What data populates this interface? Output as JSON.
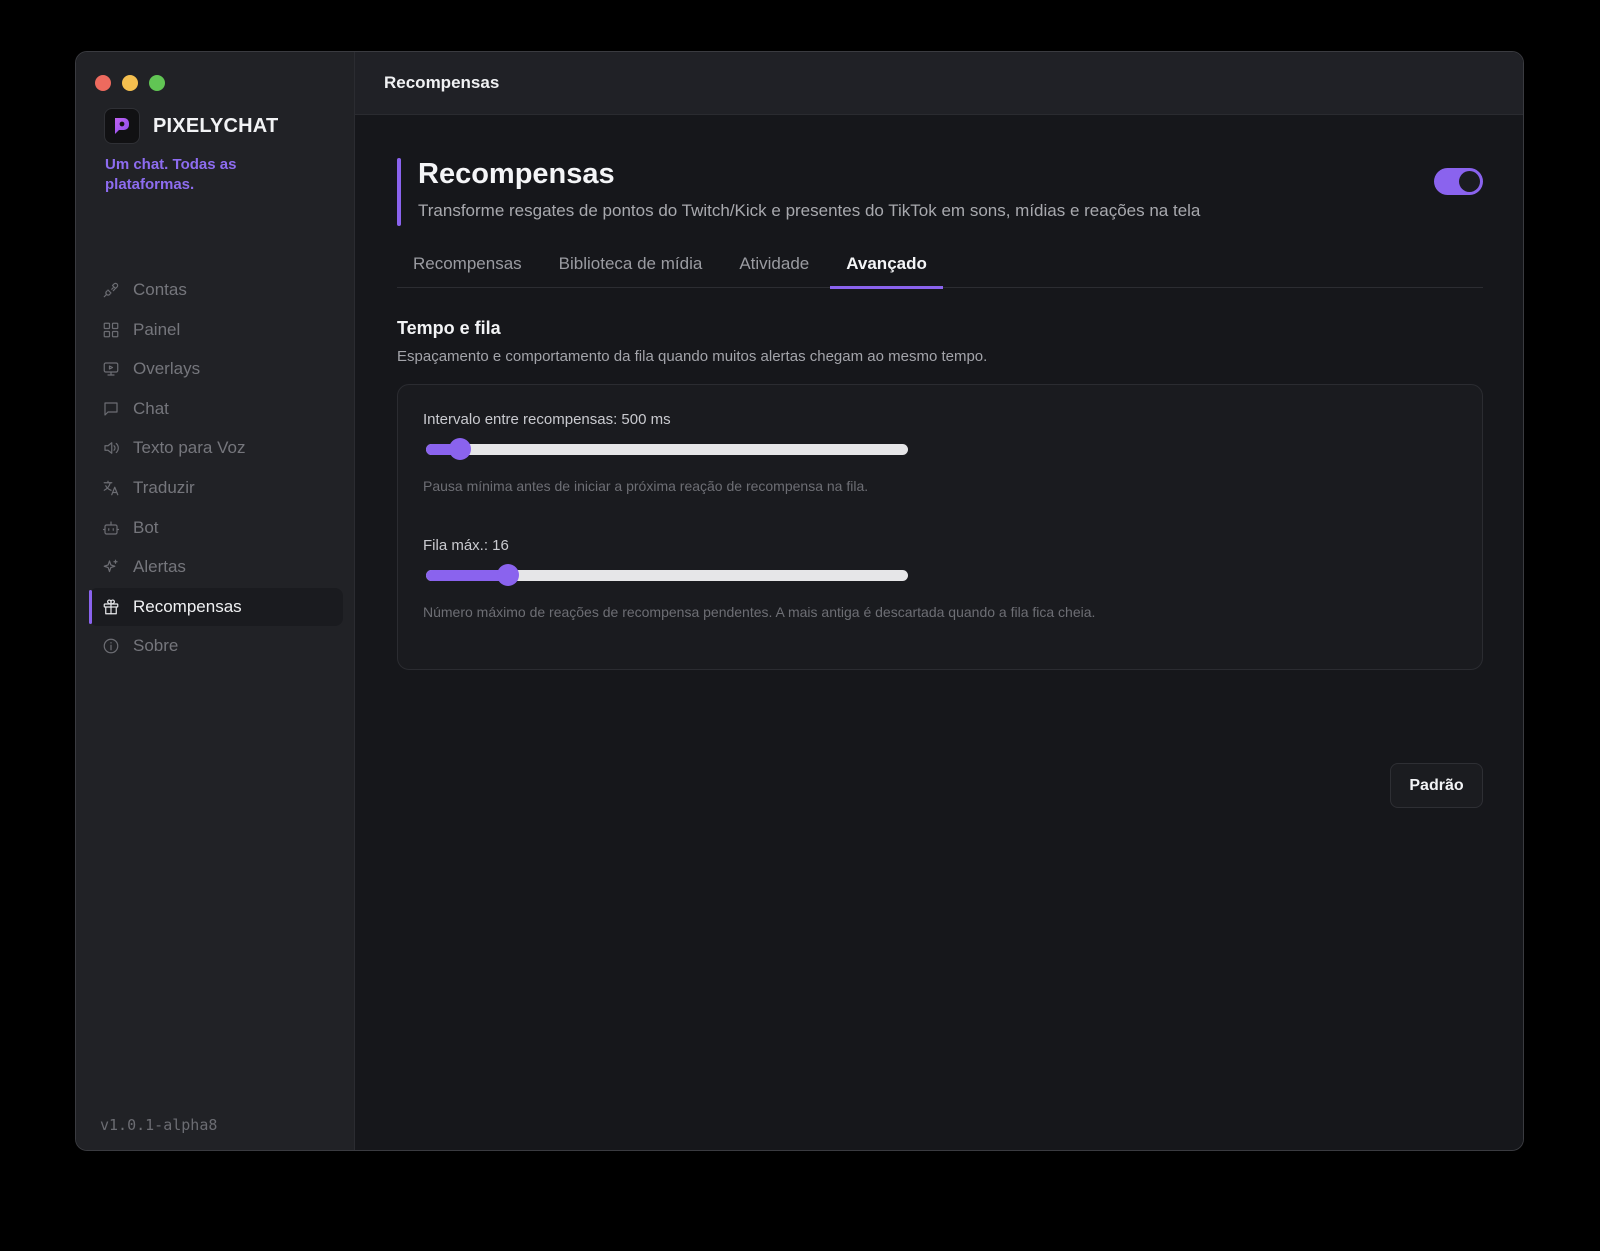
{
  "window": {
    "title": "Recompensas"
  },
  "sidebar": {
    "brand_name": "PIXELYCHAT",
    "tagline": "Um chat. Todas as plataformas.",
    "version": "v1.0.1-alpha8",
    "items": [
      {
        "label": "Contas",
        "icon": "plug-icon",
        "active": false
      },
      {
        "label": "Painel",
        "icon": "grid-icon",
        "active": false
      },
      {
        "label": "Overlays",
        "icon": "monitor-icon",
        "active": false
      },
      {
        "label": "Chat",
        "icon": "message-icon",
        "active": false
      },
      {
        "label": "Texto para Voz",
        "icon": "speaker-icon",
        "active": false
      },
      {
        "label": "Traduzir",
        "icon": "translate-icon",
        "active": false
      },
      {
        "label": "Bot",
        "icon": "bot-icon",
        "active": false
      },
      {
        "label": "Alertas",
        "icon": "sparkles-icon",
        "active": false
      },
      {
        "label": "Recompensas",
        "icon": "gift-icon",
        "active": true
      },
      {
        "label": "Sobre",
        "icon": "info-icon",
        "active": false
      }
    ]
  },
  "page": {
    "title": "Recompensas",
    "subtitle": "Transforme resgates de pontos do Twitch/Kick e presentes do TikTok em sons, mídias e reações na tela",
    "enabled": true,
    "tabs": [
      {
        "label": "Recompensas",
        "active": false
      },
      {
        "label": "Biblioteca de mídia",
        "active": false
      },
      {
        "label": "Atividade",
        "active": false
      },
      {
        "label": "Avançado",
        "active": true
      }
    ],
    "section": {
      "title": "Tempo e fila",
      "description": "Espaçamento e comportamento da fila quando muitos alertas chegam ao mesmo tempo."
    },
    "settings": [
      {
        "label": "Intervalo entre recompensas: 500 ms",
        "help": "Pausa mínima antes de iniciar a próxima reação de recompensa na fila.",
        "fraction": 0.07
      },
      {
        "label": "Fila máx.: 16",
        "help": "Número máximo de reações de recompensa pendentes. A mais antiga é descartada quando a fila fica cheia.",
        "fraction": 0.17
      }
    ],
    "reset_button": "Padrão"
  },
  "colors": {
    "accent": "#8a63ee",
    "tagline": "#8d6cf0",
    "background": "#16171b",
    "sidebar": "#212226"
  }
}
